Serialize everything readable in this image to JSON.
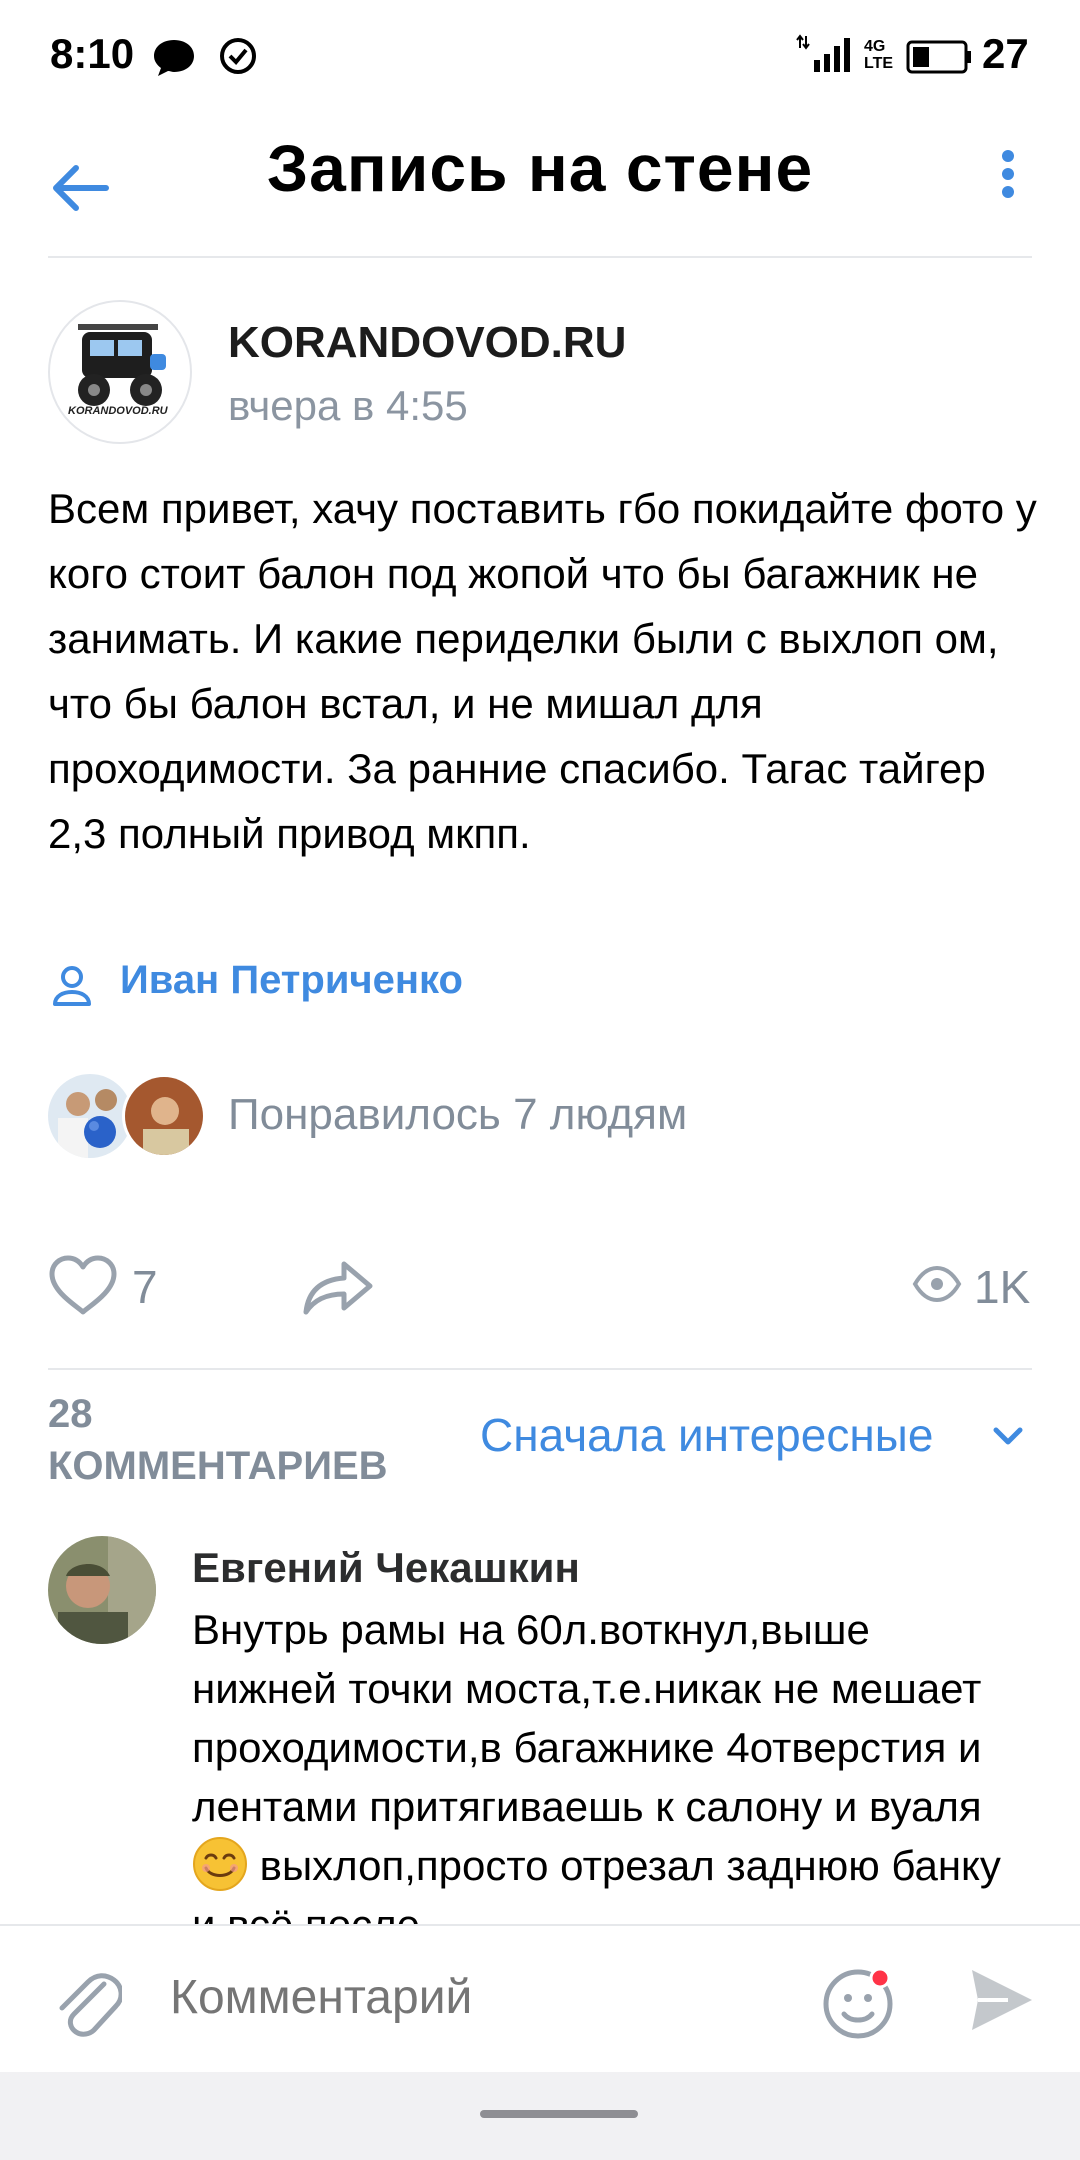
{
  "status_bar": {
    "time": "8:10",
    "network": "4G\nLTE",
    "battery": "27"
  },
  "header": {
    "title": "Запись на стене",
    "back_icon": "arrow-left-icon",
    "more_icon": "more-vertical-icon"
  },
  "post": {
    "group_name": "KORANDOVOD.RU",
    "logo_text": "KORANDOVOD.RU",
    "time": "вчера в 4:55",
    "text": "Всем привет, хачу поставить гбо покидайте фото у кого стоит балон под жопой что бы багажник не занимать. И какие периделки были с выхлоп ом, что бы балон встал, и не мишал для проходимости. За ранние спасибо. Тагас тайгер 2,3 полный привод мкпп.",
    "author": "Иван Петриченко",
    "liked_by": "Понравилось 7 людям",
    "likes": "7",
    "views": "1K"
  },
  "comments": {
    "count_number": "28",
    "count_label": "КОММЕНТАРИЕВ",
    "sort_label": "Сначала интересные",
    "items": [
      {
        "name": "Евгений Чекашкин",
        "text_before_emoji": "Внутрь рамы на 60л.воткнул,выше нижней точки моста,т.е.никак не мешает проходимости,в багажнике 4отверстия и лентами притягиваешь к салону и вуаля",
        "text_after_emoji": "выхлоп,просто отрезал заднюю банку и всё после"
      }
    ]
  },
  "composer": {
    "placeholder": "Комментарий"
  },
  "colors": {
    "accent": "#3f8ae0",
    "secondary_text": "#818c99",
    "divider": "#e6e8eb"
  }
}
